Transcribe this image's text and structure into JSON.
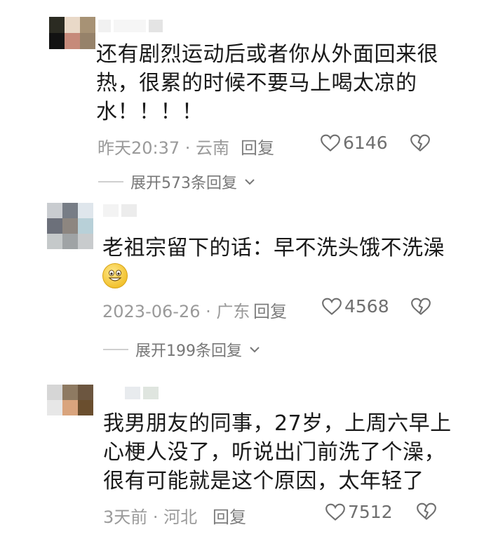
{
  "comments": [
    {
      "text": "还有剧烈运动后或者你从外面回来很\n热，很累的时候不要马上喝太凉的\n水！！！！",
      "meta": "昨天20:37 · 云南",
      "reply": "回复",
      "likes": "6146",
      "expand": "展开573条回复"
    },
    {
      "text": "老祖宗留下的话：早不洗头饿不洗澡",
      "emoji_icon": "grinning-face-emoji",
      "meta": "2023-06-26 · 广东",
      "reply": "回复",
      "likes": "4568",
      "expand": "展开199条回复"
    },
    {
      "text": "我男朋友的同事，27岁，上周六早上\n心梗人没了，听说出门前洗了个澡，\n很有可能就是这个原因，太年轻了",
      "meta": "3天前 · 河北",
      "reply": "回复",
      "likes": "7512"
    }
  ],
  "icons": {
    "like": "heart-outline-icon",
    "dislike": "broken-heart-icon",
    "expand": "chevron-down-icon"
  },
  "colors": {
    "text": "#1a1a1a",
    "meta": "#9a9a9a",
    "background": "#ffffff"
  }
}
